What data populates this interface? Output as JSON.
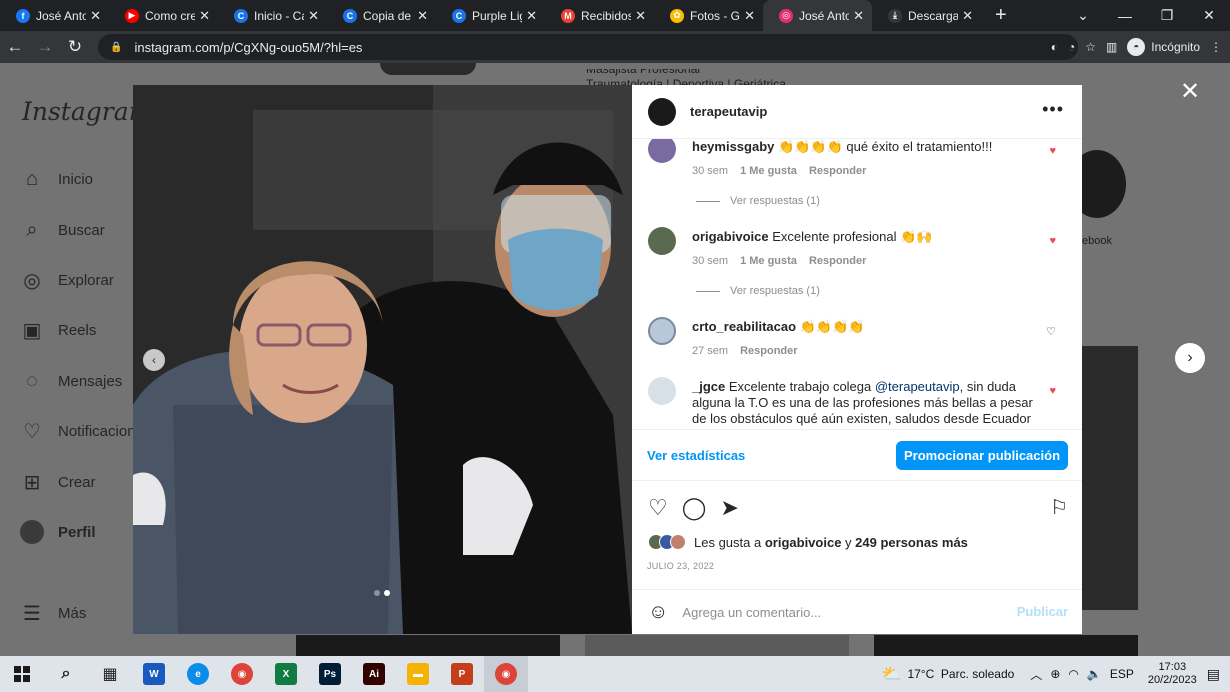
{
  "browser": {
    "tabs": [
      {
        "title": "José Antor",
        "color": "#1877f2",
        "glyph": "f"
      },
      {
        "title": "Como crea",
        "color": "#ff0000",
        "glyph": "▶"
      },
      {
        "title": "Inicio - Ca",
        "color": "#1a73e8",
        "glyph": "C"
      },
      {
        "title": "Copia de C",
        "color": "#1a73e8",
        "glyph": "C"
      },
      {
        "title": "Purple Ligh",
        "color": "#1a73e8",
        "glyph": "C"
      },
      {
        "title": "Recibidos (",
        "color": "#ea4335",
        "glyph": "M"
      },
      {
        "title": "Fotos - Go",
        "color": "#fbbc04",
        "glyph": "✿"
      },
      {
        "title": "José Anton",
        "color": "#e1306c",
        "glyph": "◎",
        "active": true
      },
      {
        "title": "Descargas",
        "color": "#35363a",
        "glyph": "⤓"
      }
    ],
    "url": "instagram.com/p/CgXNg-ouo5M/?hl=es",
    "profile_label": "Incógnito"
  },
  "sidebar": {
    "logo": "Instagram",
    "items": [
      {
        "label": "Inicio",
        "icon": "home-icon",
        "glyph": "⌂"
      },
      {
        "label": "Buscar",
        "icon": "search-icon",
        "glyph": "⌕"
      },
      {
        "label": "Explorar",
        "icon": "compass-icon",
        "glyph": "◎"
      },
      {
        "label": "Reels",
        "icon": "reels-icon",
        "glyph": "▣"
      },
      {
        "label": "Mensajes",
        "icon": "messenger-icon",
        "glyph": "◌"
      },
      {
        "label": "Notificacion",
        "icon": "heart-icon",
        "glyph": "♡"
      },
      {
        "label": "Crear",
        "icon": "plus-square-icon",
        "glyph": "⊞"
      },
      {
        "label": "Perfil",
        "icon": "profile-avatar",
        "glyph": ""
      }
    ],
    "more_label": "Más"
  },
  "background": {
    "profile_line1": "Masajista Profesional",
    "profile_line2": "Traumatología | Deportiva | Geriátrica",
    "facebook_label": "ebook"
  },
  "post": {
    "username": "terapeutavip",
    "comments": [
      {
        "user": "heymissgaby",
        "text": "👏👏👏👏 qué éxito el tratamiento!!!",
        "time": "30 sem",
        "likes": "1 Me gusta",
        "reply": "Responder",
        "liked": true,
        "view_replies": "Ver respuestas (1)"
      },
      {
        "user": "origabivoice",
        "text": "Excelente profesional 👏🙌",
        "time": "30 sem",
        "likes": "1 Me gusta",
        "reply": "Responder",
        "liked": true,
        "view_replies": "Ver respuestas (1)"
      },
      {
        "user": "crto_reabilitacao",
        "text": "👏👏👏👏",
        "time": "27 sem",
        "likes": "",
        "reply": "Responder",
        "liked": false
      },
      {
        "user": "_jgce",
        "text_before": "Excelente trabajo colega ",
        "mention": "@terapeutavip",
        "text_after": ", sin duda alguna la T.O es una de las profesiones más bellas a pesar de los obstáculos qué aún existen, saludos desde Ecuador 🇪🇨",
        "liked": true
      }
    ],
    "stats_link": "Ver estadísticas",
    "promote_button": "Promocionar publicación",
    "likes_prefix": "Les gusta a ",
    "likes_user": "origabivoice",
    "likes_middle": " y ",
    "likes_count": "249 personas más",
    "date": "JULIO 23, 2022",
    "comment_placeholder": "Agrega un comentario...",
    "publish_label": "Publicar",
    "carousel_index": 2,
    "carousel_total": 2
  },
  "taskbar": {
    "apps": [
      {
        "name": "search",
        "glyph": "⌕",
        "color": "#222"
      },
      {
        "name": "task-view",
        "glyph": "▦",
        "color": "#222"
      },
      {
        "name": "word",
        "glyph": "W",
        "color": "#185abd"
      },
      {
        "name": "edge",
        "glyph": "e",
        "color": "#0c8ce9"
      },
      {
        "name": "chrome",
        "glyph": "◉",
        "color": "#db4437"
      },
      {
        "name": "excel",
        "glyph": "X",
        "color": "#107c41"
      },
      {
        "name": "photoshop",
        "glyph": "Ps",
        "color": "#001e36"
      },
      {
        "name": "illustrator",
        "glyph": "Ai",
        "color": "#330000"
      },
      {
        "name": "explorer",
        "glyph": "▬",
        "color": "#f3b300"
      },
      {
        "name": "powerpoint",
        "glyph": "P",
        "color": "#c43e1c"
      },
      {
        "name": "chrome-one",
        "glyph": "◉",
        "color": "#db4437"
      }
    ],
    "weather": "17°C  Parc. soleado",
    "lang": "ESP",
    "time": "17:03",
    "date": "20/2/2023"
  }
}
